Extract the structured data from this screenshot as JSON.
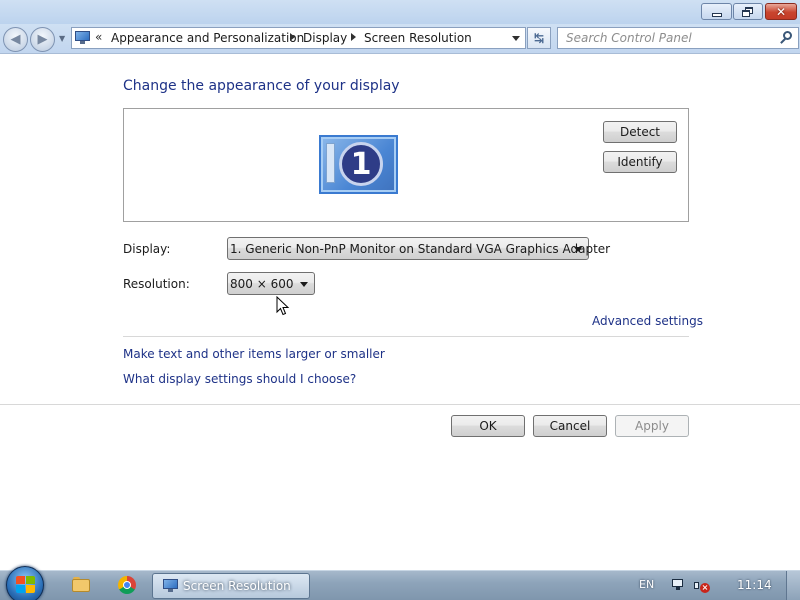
{
  "window": {
    "title": "Screen Resolution",
    "controls": [
      "minimize",
      "maximize",
      "close"
    ]
  },
  "navigation": {
    "address": {
      "overflow_chevron": "«",
      "breadcrumbs": [
        "Appearance and Personalization",
        "Display",
        "Screen Resolution"
      ]
    },
    "search_placeholder": "Search Control Panel"
  },
  "content": {
    "heading": "Change the appearance of your display",
    "monitor_preview": {
      "number": "1"
    },
    "detect_label": "Detect",
    "identify_label": "Identify",
    "display": {
      "label": "Display:",
      "value": "1. Generic Non-PnP Monitor on Standard VGA Graphics Adapter"
    },
    "resolution": {
      "label": "Resolution:",
      "value": "800 × 600"
    },
    "advanced_settings_link": "Advanced settings",
    "links": [
      "Make text and other items larger or smaller",
      "What display settings should I choose?"
    ]
  },
  "footer": {
    "ok_label": "OK",
    "cancel_label": "Cancel",
    "apply_label": "Apply",
    "apply_enabled": false
  },
  "taskbar": {
    "pinned_icons": [
      "windows-explorer-icon",
      "chrome-icon"
    ],
    "active_task_label": "Screen Resolution",
    "language": "EN",
    "tray_icons": [
      "network-icon",
      "volume-muted-icon"
    ],
    "clock": "11:14"
  },
  "colors": {
    "link_blue": "#1e3287",
    "title_bar": "#c2d6ef",
    "taskbar": "#8ea4ba"
  }
}
